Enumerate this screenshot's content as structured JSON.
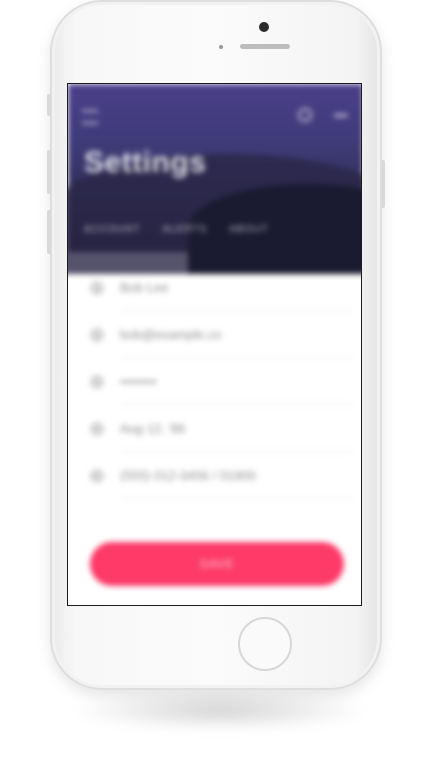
{
  "header": {
    "title": "Settings",
    "tabs": [
      {
        "label": "Account"
      },
      {
        "label": "Alerts"
      },
      {
        "label": "About"
      }
    ]
  },
  "fields": [
    {
      "icon": "user-icon",
      "value": "Bob Lee"
    },
    {
      "icon": "mail-icon",
      "value": "bob@example.co"
    },
    {
      "icon": "lock-icon",
      "value": "••••••••"
    },
    {
      "icon": "calendar-icon",
      "value": "Aug 12, '86"
    },
    {
      "icon": "phone-icon",
      "value": "(555) 012-3456 / 01900"
    }
  ],
  "cta": {
    "label": "Save"
  },
  "colors": {
    "accent": "#fd3a68",
    "header_top": "#4a3f8a",
    "header_bottom": "#17182b"
  }
}
